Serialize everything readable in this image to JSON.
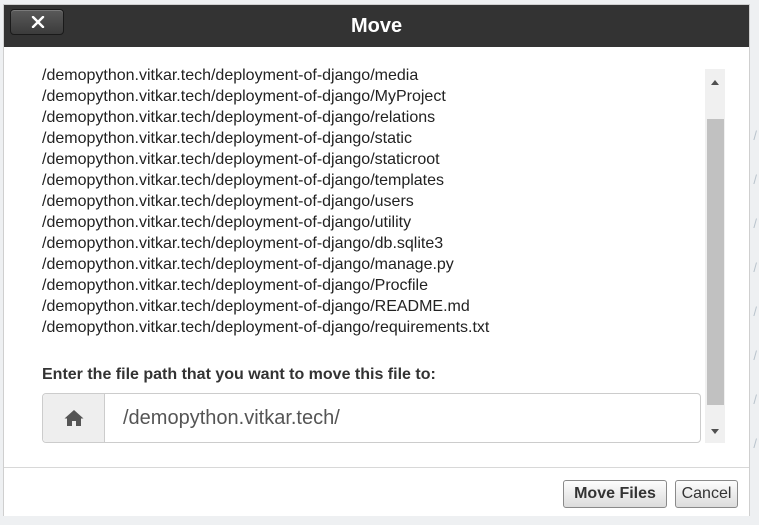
{
  "dialog": {
    "title": "Move",
    "paths": [
      "/demopython.vitkar.tech/deployment-of-django/media",
      "/demopython.vitkar.tech/deployment-of-django/MyProject",
      "/demopython.vitkar.tech/deployment-of-django/relations",
      "/demopython.vitkar.tech/deployment-of-django/static",
      "/demopython.vitkar.tech/deployment-of-django/staticroot",
      "/demopython.vitkar.tech/deployment-of-django/templates",
      "/demopython.vitkar.tech/deployment-of-django/users",
      "/demopython.vitkar.tech/deployment-of-django/utility",
      "/demopython.vitkar.tech/deployment-of-django/db.sqlite3",
      "/demopython.vitkar.tech/deployment-of-django/manage.py",
      "/demopython.vitkar.tech/deployment-of-django/Procfile",
      "/demopython.vitkar.tech/deployment-of-django/README.md",
      "/demopython.vitkar.tech/deployment-of-django/requirements.txt"
    ],
    "prompt_label": "Enter the file path that you want to move this file to:",
    "destination_value": "/demopython.vitkar.tech/",
    "move_button_label": "Move Files",
    "cancel_button_label": "Cancel"
  },
  "icons": {
    "close": "close-icon",
    "home": "home-icon",
    "scroll_up": "scroll-up-arrow-icon",
    "scroll_down": "scroll-down-arrow-icon"
  },
  "colors": {
    "titlebar": "#333333",
    "title_text": "#ffffff",
    "addon_background": "#eeeeee",
    "scroll_thumb": "#c1c1c1"
  }
}
